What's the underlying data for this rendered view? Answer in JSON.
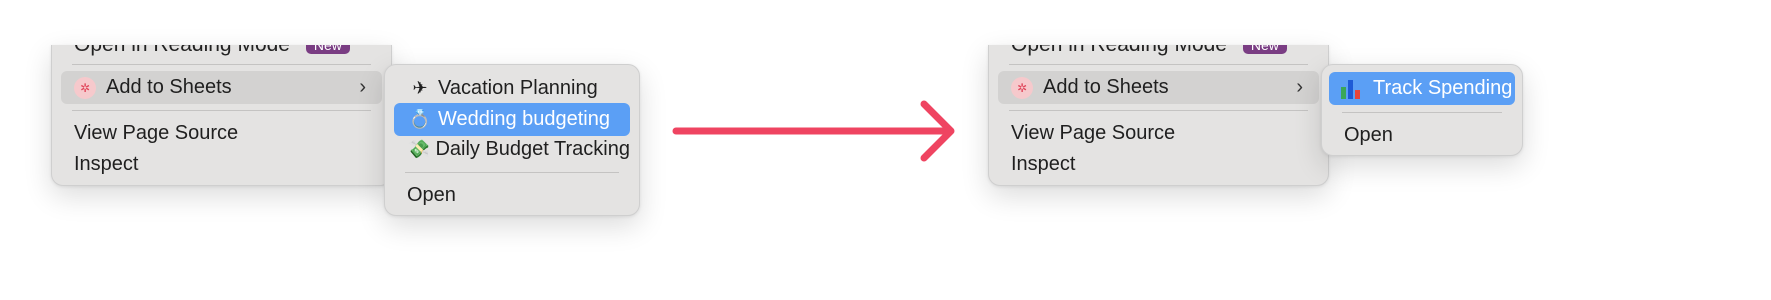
{
  "left": {
    "context_menu": {
      "truncated_item_label": "Open in Reading Mode",
      "truncated_item_badge": "New",
      "add_to_sheets_label": "Add to Sheets",
      "view_source_label": "View Page Source",
      "inspect_label": "Inspect"
    },
    "submenu": {
      "items": [
        {
          "label": "Vacation Planning",
          "icon": "airplane-icon"
        },
        {
          "label": "Wedding budgeting",
          "icon": "ring-icon"
        },
        {
          "label": "Daily Budget Tracking",
          "icon": "money-with-wings-icon"
        }
      ],
      "selected_index": 1,
      "open_label": "Open"
    }
  },
  "arrow": {
    "icon": "right-arrow-icon",
    "color": "#ef4461"
  },
  "right": {
    "context_menu": {
      "truncated_item_label": "Open in Reading Mode",
      "truncated_item_badge": "New",
      "add_to_sheets_label": "Add to Sheets",
      "view_source_label": "View Page Source",
      "inspect_label": "Inspect"
    },
    "submenu": {
      "items": [
        {
          "label": "Track Spending",
          "icon": "bar-chart-icon"
        }
      ],
      "selected_index": 0,
      "open_label": "Open"
    }
  },
  "colors": {
    "selection": "#5b9ff5",
    "menu_bg": "#e4e3e2",
    "badge": "#7a3d83",
    "accent_arrow": "#ef4461"
  }
}
